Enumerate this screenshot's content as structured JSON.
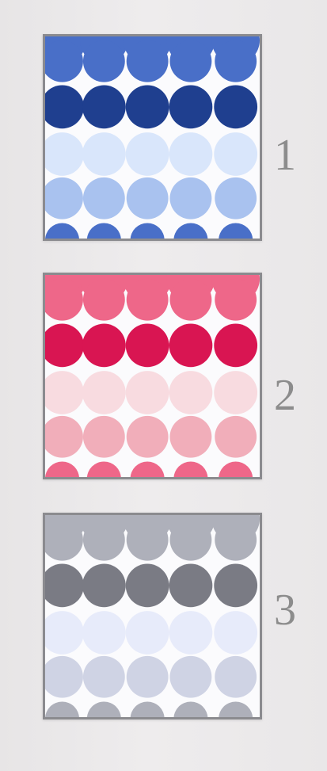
{
  "swatches": [
    {
      "number": "1",
      "colors": {
        "row1": "#496fc8",
        "row2": "#1f3f8f",
        "row3": "#d9e6fb",
        "row4": "#a9c2ef",
        "row5": "#496fc8"
      }
    },
    {
      "number": "2",
      "colors": {
        "row1": "#ee6789",
        "row2": "#d91552",
        "row3": "#f8dbe0",
        "row4": "#f1aeba",
        "row5": "#ee6789"
      }
    },
    {
      "number": "3",
      "colors": {
        "row1": "#aeb0ba",
        "row2": "#7a7b84",
        "row3": "#e7ebfa",
        "row4": "#cfd3e4",
        "row5": "#aeb0ba"
      }
    }
  ]
}
